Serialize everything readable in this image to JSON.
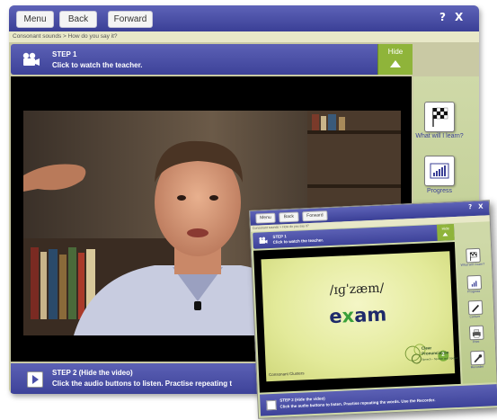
{
  "main": {
    "topbar": {
      "menu_label": "Menu",
      "back_label": "Back",
      "forward_label": "Forward",
      "help_glyph": "?",
      "close_glyph": "X"
    },
    "breadcrumb": "Consonant sounds > How do you say it?",
    "step1": {
      "title": "STEP 1",
      "subtitle": "Click to watch the teacher.",
      "hide_label": "Hide",
      "icon": "video-camera-icon"
    },
    "sidebar": [
      {
        "label": "What will I learn?",
        "icon": "checkered-flag-icon"
      },
      {
        "label": "Progress",
        "icon": "progress-chart-icon"
      }
    ],
    "step2": {
      "title": "STEP 2 (Hide the video)",
      "subtitle": "Click the audio buttons to listen. Practise repeating t",
      "icon": "play-icon"
    }
  },
  "inset": {
    "topbar": {
      "menu_label": "Menu",
      "back_label": "Back",
      "forward_label": "Forward",
      "help_glyph": "?",
      "close_glyph": "X"
    },
    "breadcrumb": "Consonant sounds > How do you say it?",
    "step1": {
      "title": "STEP 1",
      "subtitle": "Click to watch the teacher.",
      "hide_label": "Hide"
    },
    "slide": {
      "phonetic": "/ɪɡˈzæm/",
      "word_before": "e",
      "word_highlight": "x",
      "word_after": "am",
      "caption": "Consonant Clusters",
      "logo_line1": "Clear",
      "logo_line2": "Pronunciation",
      "logo_number": "2",
      "logo_tagline": "Speech – Spoken and Spoken"
    },
    "sidebar": [
      {
        "label": "What will I learn?",
        "icon": "checkered-flag-icon"
      },
      {
        "label": "Progress",
        "icon": "progress-chart-icon"
      },
      {
        "label": "Lecture",
        "icon": "pencil-icon"
      },
      {
        "label": "Print",
        "icon": "printer-icon"
      },
      {
        "label": "Recorder",
        "icon": "wrench-icon"
      }
    ],
    "step2": {
      "title": "STEP 2 (Hide the video)",
      "subtitle": "Click the audio buttons to listen. Practise repeating the words. Use the Recorder."
    }
  },
  "colors": {
    "bar_blue": "#4a4fa8",
    "hide_green": "#8fb43a",
    "sidebar_green": "#c9d59c",
    "slide_yellow": "#eaf0a8",
    "word_x_green": "#3aa03a"
  }
}
